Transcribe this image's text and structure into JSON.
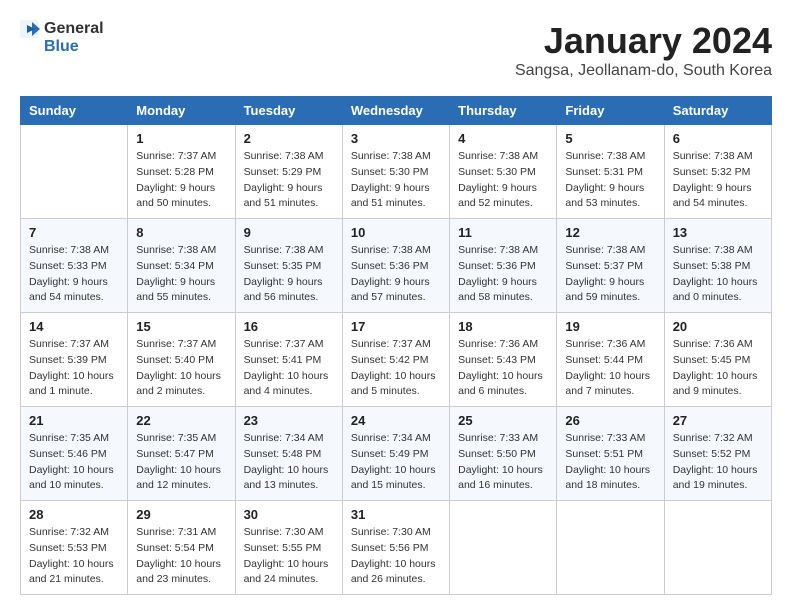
{
  "logo": {
    "line1": "General",
    "line2": "Blue"
  },
  "title": "January 2024",
  "location": "Sangsa, Jeollanam-do, South Korea",
  "days_of_week": [
    "Sunday",
    "Monday",
    "Tuesday",
    "Wednesday",
    "Thursday",
    "Friday",
    "Saturday"
  ],
  "weeks": [
    [
      {
        "day": "",
        "sunrise": "",
        "sunset": "",
        "daylight": ""
      },
      {
        "day": "1",
        "sunrise": "Sunrise: 7:37 AM",
        "sunset": "Sunset: 5:28 PM",
        "daylight": "Daylight: 9 hours and 50 minutes."
      },
      {
        "day": "2",
        "sunrise": "Sunrise: 7:38 AM",
        "sunset": "Sunset: 5:29 PM",
        "daylight": "Daylight: 9 hours and 51 minutes."
      },
      {
        "day": "3",
        "sunrise": "Sunrise: 7:38 AM",
        "sunset": "Sunset: 5:30 PM",
        "daylight": "Daylight: 9 hours and 51 minutes."
      },
      {
        "day": "4",
        "sunrise": "Sunrise: 7:38 AM",
        "sunset": "Sunset: 5:30 PM",
        "daylight": "Daylight: 9 hours and 52 minutes."
      },
      {
        "day": "5",
        "sunrise": "Sunrise: 7:38 AM",
        "sunset": "Sunset: 5:31 PM",
        "daylight": "Daylight: 9 hours and 53 minutes."
      },
      {
        "day": "6",
        "sunrise": "Sunrise: 7:38 AM",
        "sunset": "Sunset: 5:32 PM",
        "daylight": "Daylight: 9 hours and 54 minutes."
      }
    ],
    [
      {
        "day": "7",
        "sunrise": "Sunrise: 7:38 AM",
        "sunset": "Sunset: 5:33 PM",
        "daylight": "Daylight: 9 hours and 54 minutes."
      },
      {
        "day": "8",
        "sunrise": "Sunrise: 7:38 AM",
        "sunset": "Sunset: 5:34 PM",
        "daylight": "Daylight: 9 hours and 55 minutes."
      },
      {
        "day": "9",
        "sunrise": "Sunrise: 7:38 AM",
        "sunset": "Sunset: 5:35 PM",
        "daylight": "Daylight: 9 hours and 56 minutes."
      },
      {
        "day": "10",
        "sunrise": "Sunrise: 7:38 AM",
        "sunset": "Sunset: 5:36 PM",
        "daylight": "Daylight: 9 hours and 57 minutes."
      },
      {
        "day": "11",
        "sunrise": "Sunrise: 7:38 AM",
        "sunset": "Sunset: 5:36 PM",
        "daylight": "Daylight: 9 hours and 58 minutes."
      },
      {
        "day": "12",
        "sunrise": "Sunrise: 7:38 AM",
        "sunset": "Sunset: 5:37 PM",
        "daylight": "Daylight: 9 hours and 59 minutes."
      },
      {
        "day": "13",
        "sunrise": "Sunrise: 7:38 AM",
        "sunset": "Sunset: 5:38 PM",
        "daylight": "Daylight: 10 hours and 0 minutes."
      }
    ],
    [
      {
        "day": "14",
        "sunrise": "Sunrise: 7:37 AM",
        "sunset": "Sunset: 5:39 PM",
        "daylight": "Daylight: 10 hours and 1 minute."
      },
      {
        "day": "15",
        "sunrise": "Sunrise: 7:37 AM",
        "sunset": "Sunset: 5:40 PM",
        "daylight": "Daylight: 10 hours and 2 minutes."
      },
      {
        "day": "16",
        "sunrise": "Sunrise: 7:37 AM",
        "sunset": "Sunset: 5:41 PM",
        "daylight": "Daylight: 10 hours and 4 minutes."
      },
      {
        "day": "17",
        "sunrise": "Sunrise: 7:37 AM",
        "sunset": "Sunset: 5:42 PM",
        "daylight": "Daylight: 10 hours and 5 minutes."
      },
      {
        "day": "18",
        "sunrise": "Sunrise: 7:36 AM",
        "sunset": "Sunset: 5:43 PM",
        "daylight": "Daylight: 10 hours and 6 minutes."
      },
      {
        "day": "19",
        "sunrise": "Sunrise: 7:36 AM",
        "sunset": "Sunset: 5:44 PM",
        "daylight": "Daylight: 10 hours and 7 minutes."
      },
      {
        "day": "20",
        "sunrise": "Sunrise: 7:36 AM",
        "sunset": "Sunset: 5:45 PM",
        "daylight": "Daylight: 10 hours and 9 minutes."
      }
    ],
    [
      {
        "day": "21",
        "sunrise": "Sunrise: 7:35 AM",
        "sunset": "Sunset: 5:46 PM",
        "daylight": "Daylight: 10 hours and 10 minutes."
      },
      {
        "day": "22",
        "sunrise": "Sunrise: 7:35 AM",
        "sunset": "Sunset: 5:47 PM",
        "daylight": "Daylight: 10 hours and 12 minutes."
      },
      {
        "day": "23",
        "sunrise": "Sunrise: 7:34 AM",
        "sunset": "Sunset: 5:48 PM",
        "daylight": "Daylight: 10 hours and 13 minutes."
      },
      {
        "day": "24",
        "sunrise": "Sunrise: 7:34 AM",
        "sunset": "Sunset: 5:49 PM",
        "daylight": "Daylight: 10 hours and 15 minutes."
      },
      {
        "day": "25",
        "sunrise": "Sunrise: 7:33 AM",
        "sunset": "Sunset: 5:50 PM",
        "daylight": "Daylight: 10 hours and 16 minutes."
      },
      {
        "day": "26",
        "sunrise": "Sunrise: 7:33 AM",
        "sunset": "Sunset: 5:51 PM",
        "daylight": "Daylight: 10 hours and 18 minutes."
      },
      {
        "day": "27",
        "sunrise": "Sunrise: 7:32 AM",
        "sunset": "Sunset: 5:52 PM",
        "daylight": "Daylight: 10 hours and 19 minutes."
      }
    ],
    [
      {
        "day": "28",
        "sunrise": "Sunrise: 7:32 AM",
        "sunset": "Sunset: 5:53 PM",
        "daylight": "Daylight: 10 hours and 21 minutes."
      },
      {
        "day": "29",
        "sunrise": "Sunrise: 7:31 AM",
        "sunset": "Sunset: 5:54 PM",
        "daylight": "Daylight: 10 hours and 23 minutes."
      },
      {
        "day": "30",
        "sunrise": "Sunrise: 7:30 AM",
        "sunset": "Sunset: 5:55 PM",
        "daylight": "Daylight: 10 hours and 24 minutes."
      },
      {
        "day": "31",
        "sunrise": "Sunrise: 7:30 AM",
        "sunset": "Sunset: 5:56 PM",
        "daylight": "Daylight: 10 hours and 26 minutes."
      },
      {
        "day": "",
        "sunrise": "",
        "sunset": "",
        "daylight": ""
      },
      {
        "day": "",
        "sunrise": "",
        "sunset": "",
        "daylight": ""
      },
      {
        "day": "",
        "sunrise": "",
        "sunset": "",
        "daylight": ""
      }
    ]
  ]
}
